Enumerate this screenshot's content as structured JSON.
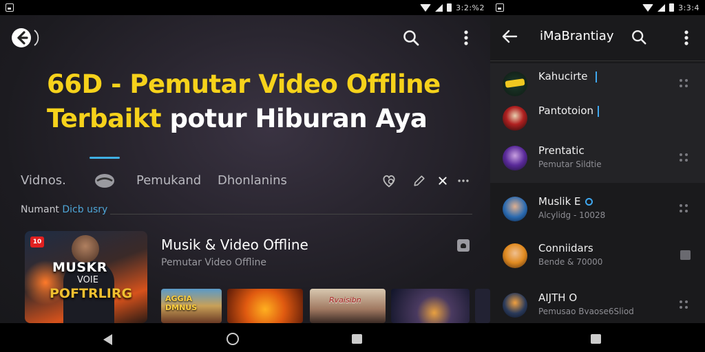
{
  "status_bar": {
    "left_time": "3:2:%2",
    "right_time": "3:3:4"
  },
  "left": {
    "headline_yellow_1": "66D - Pemutar Video Offline",
    "headline_yellow_2": "Terbaikt",
    "headline_white": " potur Hiburan Aya",
    "tabs": [
      "Vidnos.",
      "Pemukand",
      "Dhonlanins"
    ],
    "section_label_a": "Numant ",
    "section_label_b": "Dicb usry",
    "feature": {
      "badge": "10",
      "thumb_line1": "MUSKR",
      "thumb_line2": "VOIE",
      "thumb_line3": "POFTRLIRG",
      "title": "Musik & Video Offline",
      "subtitle": "Pemutar Video Offline"
    },
    "thumbs": [
      {
        "text": "AGGIA DMNUS"
      },
      {
        "text": ""
      },
      {
        "text": "Rvaisibn"
      },
      {
        "text": ""
      }
    ]
  },
  "right": {
    "title": "iMaBrantiay",
    "contacts": [
      {
        "name": "Kahucirte",
        "sub": ""
      },
      {
        "name": "Pantotoion",
        "sub": ""
      },
      {
        "name": "Prentatic",
        "sub": "Pemutar Sildtie"
      },
      {
        "name": "Muslik E",
        "sub": "Alcylidg - 10028"
      },
      {
        "name": "Conniidars",
        "sub": "Bende & 70000"
      },
      {
        "name": "AIJTH O",
        "sub": "Pemusao Bvaose6Sliod"
      }
    ]
  },
  "colors": {
    "accent": "#3fb0e4",
    "headline_yellow": "#f6d21b"
  }
}
